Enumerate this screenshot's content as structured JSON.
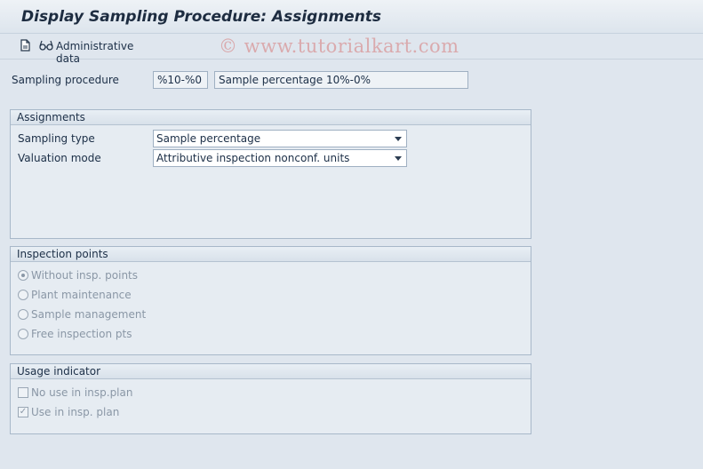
{
  "window": {
    "title": "Display Sampling Procedure: Assignments"
  },
  "toolbar": {
    "doc_icon": "document-icon",
    "admin_icon": "glasses-icon",
    "admin_label": "Administrative data"
  },
  "watermark": "© www.tutorialkart.com",
  "header": {
    "sampling_procedure_label": "Sampling procedure",
    "sampling_procedure_value": "%10-%0",
    "sampling_procedure_desc": "Sample percentage 10%-0%"
  },
  "assignments": {
    "title": "Assignments",
    "sampling_type_label": "Sampling type",
    "sampling_type_value": "Sample percentage",
    "valuation_mode_label": "Valuation mode",
    "valuation_mode_value": "Attributive inspection nonconf. units"
  },
  "inspection_points": {
    "title": "Inspection points",
    "options": [
      {
        "label": "Without insp. points",
        "selected": true
      },
      {
        "label": "Plant maintenance",
        "selected": false
      },
      {
        "label": "Sample management",
        "selected": false
      },
      {
        "label": "Free inspection pts",
        "selected": false
      }
    ]
  },
  "usage_indicator": {
    "title": "Usage indicator",
    "options": [
      {
        "label": "No use in insp.plan",
        "checked": false
      },
      {
        "label": "Use in insp. plan",
        "checked": true
      }
    ]
  }
}
